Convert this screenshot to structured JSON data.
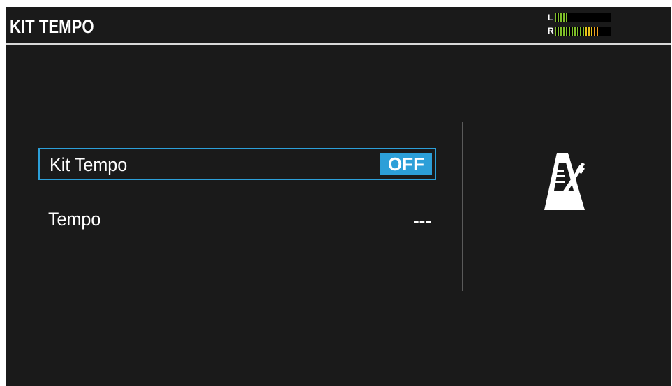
{
  "header": {
    "title": "KIT TEMPO",
    "meter": {
      "left_label": "L",
      "right_label": "R",
      "left_level_segments": 5,
      "right_level_segments": 16,
      "colors": {
        "green": "#7fbf2a",
        "yellow": "#e8c21a",
        "orange": "#f0a020"
      }
    }
  },
  "params": [
    {
      "label": "Kit Tempo",
      "value": "OFF",
      "selected": true
    },
    {
      "label": "Tempo",
      "value": "---",
      "selected": false
    }
  ],
  "icon": "metronome-icon",
  "colors": {
    "background": "#1a1a1a",
    "accent": "#2c9fd8",
    "text": "#ffffff"
  }
}
